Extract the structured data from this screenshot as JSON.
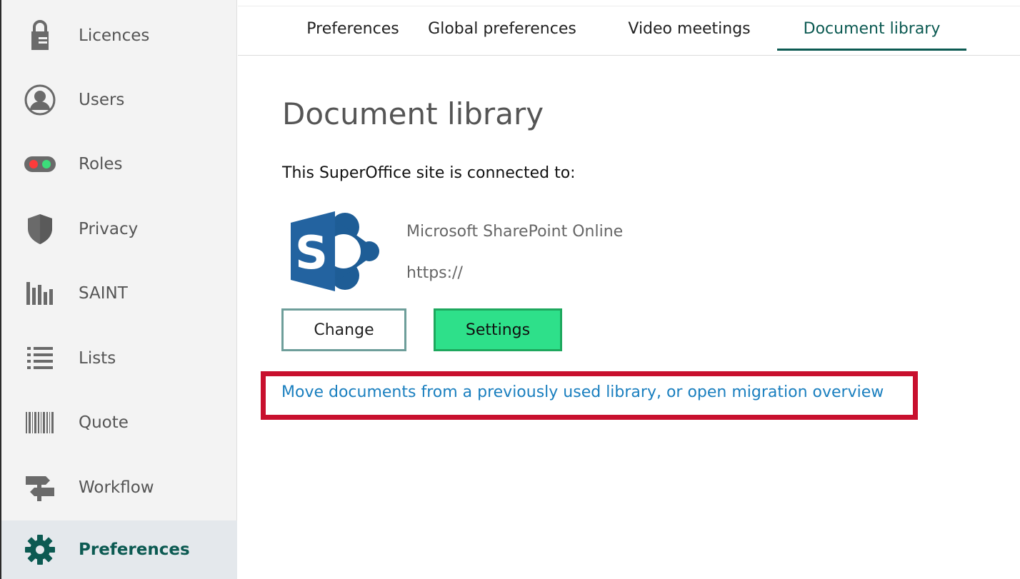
{
  "sidebar": {
    "items": [
      {
        "label": "Licences",
        "icon": "lock-icon"
      },
      {
        "label": "Users",
        "icon": "user-icon"
      },
      {
        "label": "Roles",
        "icon": "roles-toggle-icon"
      },
      {
        "label": "Privacy",
        "icon": "shield-icon"
      },
      {
        "label": "SAINT",
        "icon": "bar-chart-icon"
      },
      {
        "label": "Lists",
        "icon": "list-icon"
      },
      {
        "label": "Quote",
        "icon": "barcode-icon"
      },
      {
        "label": "Workflow",
        "icon": "signpost-icon"
      },
      {
        "label": "Preferences",
        "icon": "gear-icon",
        "active": true
      }
    ]
  },
  "tabs": [
    {
      "label": "Preferences"
    },
    {
      "label": "Global preferences"
    },
    {
      "label": "Video meetings"
    },
    {
      "label": "Document library",
      "active": true
    }
  ],
  "main": {
    "title": "Document library",
    "connected_text": "This SuperOffice site is connected to:",
    "provider_name": "Microsoft SharePoint Online",
    "provider_url": "https://",
    "change_label": "Change",
    "settings_label": "Settings",
    "migrate_link": "Move documents from a previously used library, or open migration overview"
  },
  "colors": {
    "accent": "#0c5a52",
    "settings_button": "#2ee08a",
    "link": "#1a7fbf",
    "highlight": "#c8102e",
    "sharepoint_blue": "#1e5d96"
  }
}
